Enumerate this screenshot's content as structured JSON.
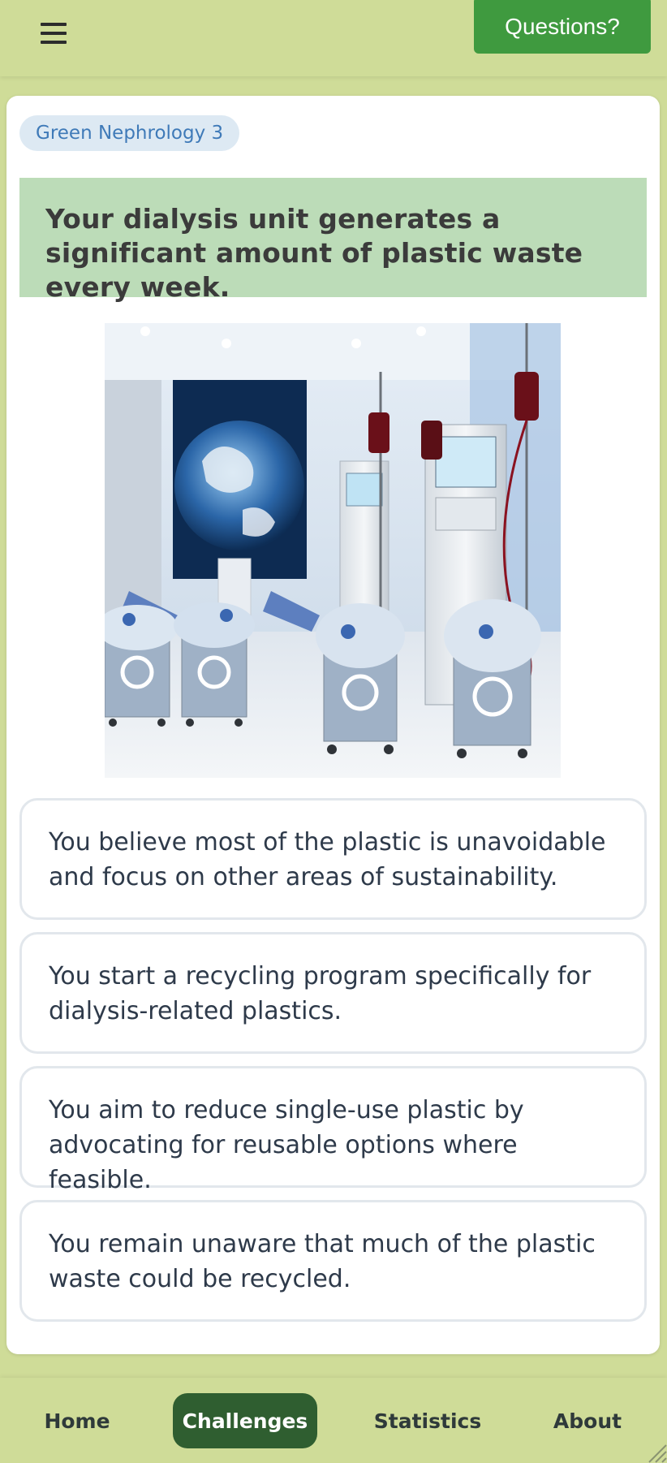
{
  "header": {
    "menu_icon": "hamburger-menu-icon",
    "questions_label": "Questions?",
    "colors": {
      "bar": "#cfdc98",
      "button": "#3f9a3f"
    }
  },
  "card": {
    "tag": "Green Nephrology 3",
    "prompt": "Your dialysis unit generates a significant amount of plastic waste every week.",
    "options": [
      "You believe most of the plastic is unavoidable and focus on other areas of sustainability.",
      "You start a recycling program specifically for dialysis-related plastics.",
      "You aim to reduce single-use plastic by advocating for reusable options where feasible.",
      "You remain unaware that much of the plastic waste could be recycled."
    ]
  },
  "nav": {
    "items": [
      "Home",
      "Challenges",
      "Statistics",
      "About"
    ],
    "active": "Challenges",
    "colors": {
      "active_bg": "#2f5e30",
      "text": "#2f3a3a"
    }
  }
}
